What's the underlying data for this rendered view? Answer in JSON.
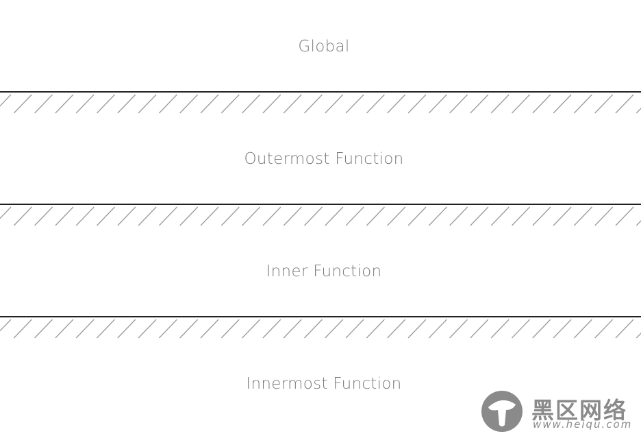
{
  "scopes": [
    {
      "label": "Global"
    },
    {
      "label": "Outermost Function"
    },
    {
      "label": "Inner Function"
    },
    {
      "label": "Innermost Function"
    }
  ],
  "colors": {
    "text": "#7a7a7a",
    "boundary": "#222222",
    "hatch": "#9a9a9a"
  },
  "watermark": {
    "title": "黑区网络",
    "url": "www.heiqu.com"
  }
}
